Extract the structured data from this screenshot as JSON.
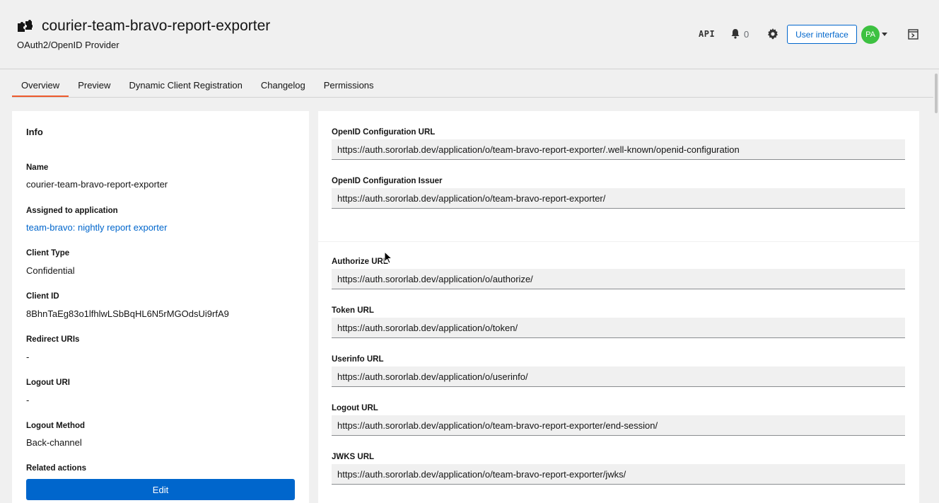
{
  "header": {
    "title": "courier-team-bravo-report-exporter",
    "subtitle": "OAuth2/OpenID Provider",
    "api_label": "API",
    "notification_count": "0",
    "ui_button": "User interface",
    "avatar_initials": "PA"
  },
  "tabs": [
    {
      "label": "Overview",
      "active": true
    },
    {
      "label": "Preview"
    },
    {
      "label": "Dynamic Client Registration"
    },
    {
      "label": "Changelog"
    },
    {
      "label": "Permissions"
    }
  ],
  "info": {
    "title": "Info",
    "fields": [
      {
        "label": "Name",
        "value": "courier-team-bravo-report-exporter"
      },
      {
        "label": "Assigned to application",
        "value": "team-bravo: nightly report exporter"
      },
      {
        "label": "Client Type",
        "value": "Confidential"
      },
      {
        "label": "Client ID",
        "value": "8BhnTaEg83o1lfhlwLSbBqHL6N5rMGOdsUi9rfA9"
      },
      {
        "label": "Redirect URIs",
        "value": "-"
      },
      {
        "label": "Logout URI",
        "value": "-"
      },
      {
        "label": "Logout Method",
        "value": "Back-channel"
      },
      {
        "label": "Related actions",
        "value": ""
      }
    ],
    "edit_button": "Edit"
  },
  "urls_top": [
    {
      "label": "OpenID Configuration URL",
      "value": "https://auth.sororlab.dev/application/o/team-bravo-report-exporter/.well-known/openid-configuration"
    },
    {
      "label": "OpenID Configuration Issuer",
      "value": "https://auth.sororlab.dev/application/o/team-bravo-report-exporter/"
    }
  ],
  "urls_bottom": [
    {
      "label": "Authorize URL",
      "value": "https://auth.sororlab.dev/application/o/authorize/"
    },
    {
      "label": "Token URL",
      "value": "https://auth.sororlab.dev/application/o/token/"
    },
    {
      "label": "Userinfo URL",
      "value": "https://auth.sororlab.dev/application/o/userinfo/"
    },
    {
      "label": "Logout URL",
      "value": "https://auth.sororlab.dev/application/o/team-bravo-report-exporter/end-session/"
    },
    {
      "label": "JWKS URL",
      "value": "https://auth.sororlab.dev/application/o/team-bravo-report-exporter/jwks/"
    }
  ],
  "colors": {
    "primary": "#0066cc",
    "tab_active": "#ee5a2c",
    "avatar": "#3dc141"
  }
}
